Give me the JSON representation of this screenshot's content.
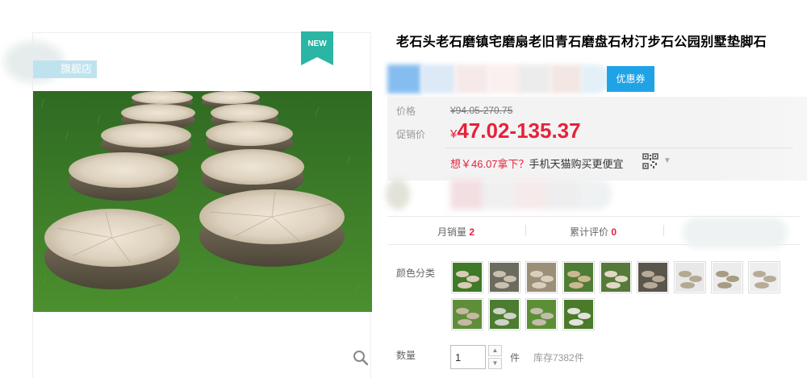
{
  "product": {
    "title": "老石头老石磨镇宅磨扇老旧青石磨盘石材汀步石公园别墅垫脚石"
  },
  "gallery": {
    "shop_badge": "旗舰店",
    "new_ribbon": "NEW",
    "zoom_icon": "search-icon"
  },
  "coupon": {
    "label": "优惠券"
  },
  "price": {
    "orig_label": "价格",
    "orig_value": "¥94.05-270.75",
    "promo_label": "促销价",
    "promo_currency": "¥",
    "promo_value": "47.02-135.37"
  },
  "mobile_deal": {
    "prefix": "想￥46.07拿下？",
    "suffix": "手机天猫购买更便宜",
    "qr_icon": "qr-code-icon",
    "caret_icon": "caret-down-icon"
  },
  "stats": {
    "monthly_sales_label": "月销量",
    "monthly_sales_value": "2",
    "reviews_label": "累计评价",
    "reviews_value": "0"
  },
  "options": {
    "color_label": "颜色分类",
    "swatch_count": 13
  },
  "quantity": {
    "label": "数量",
    "value": "1",
    "unit": "件",
    "stock": "库存7382件"
  },
  "colors": {
    "accent_red": "#e8213a",
    "coupon_blue": "#1fa3e6",
    "ribbon_teal": "#2bb5a4",
    "grass_green": "#3e7a27"
  }
}
